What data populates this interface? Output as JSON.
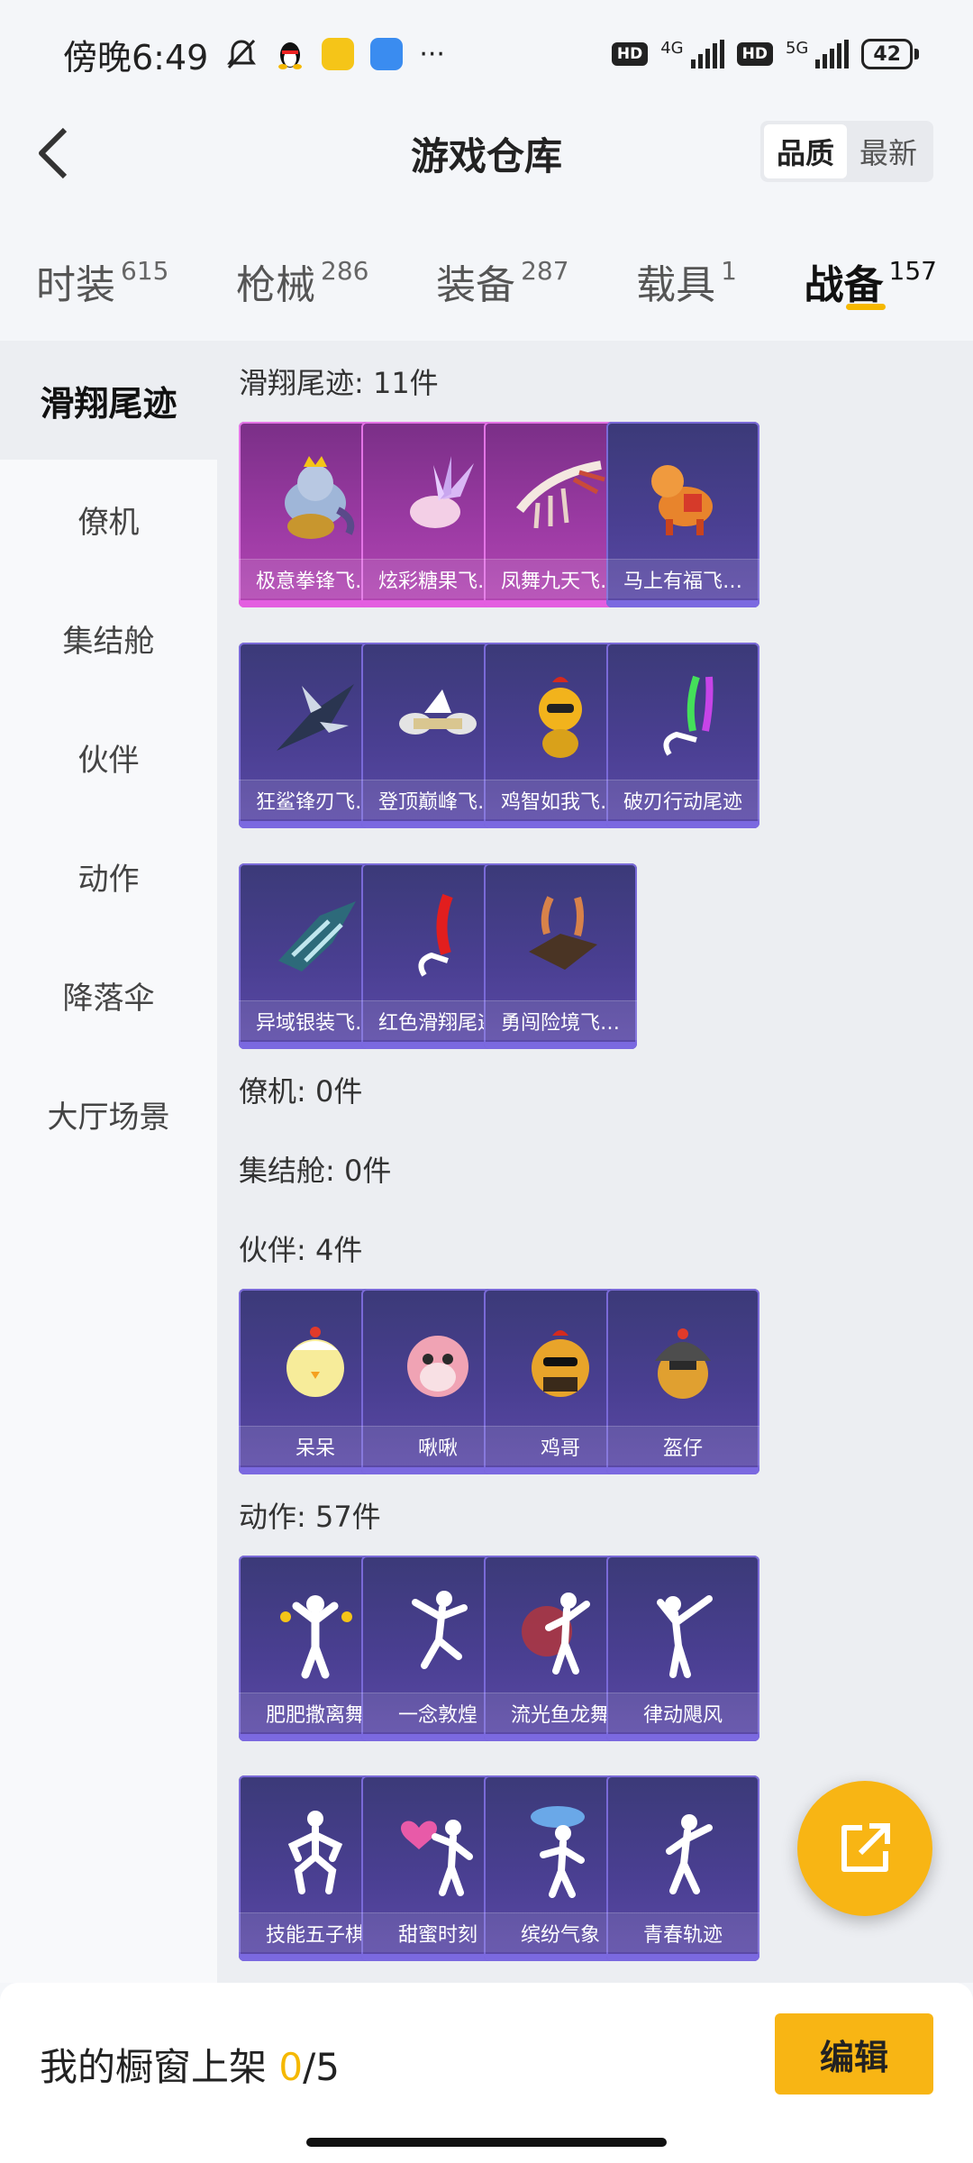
{
  "status_bar": {
    "time": "傍晚6:49",
    "network_1": "4G",
    "network_2": "5G",
    "hd_1": "HD",
    "hd_2": "HD",
    "battery": "42",
    "more": "···"
  },
  "header": {
    "title": "游戏仓库",
    "sort_options": [
      "品质",
      "最新"
    ],
    "active_sort": "品质"
  },
  "tabs": [
    {
      "label": "时装",
      "count": "615"
    },
    {
      "label": "枪械",
      "count": "286"
    },
    {
      "label": "装备",
      "count": "287"
    },
    {
      "label": "载具",
      "count": "1"
    },
    {
      "label": "战备",
      "count": "157"
    }
  ],
  "active_tab": "战备",
  "sidebar": {
    "items": [
      "滑翔尾迹",
      "僚机",
      "集结舱",
      "伙伴",
      "动作",
      "降落伞",
      "大厅场景"
    ],
    "active": "滑翔尾迹"
  },
  "sections": {
    "glide": {
      "title": "滑翔尾迹: 11件",
      "items": [
        {
          "name": "极意拳锋飞…",
          "quality": "purple",
          "icon": "elephant-rider-icon"
        },
        {
          "name": "炫彩糖果飞…",
          "quality": "purple",
          "icon": "candy-wings-icon"
        },
        {
          "name": "凤舞九天飞…",
          "quality": "purple",
          "icon": "phoenix-feather-icon"
        },
        {
          "name": "马上有福飞…",
          "quality": "blue",
          "icon": "toy-horse-icon"
        },
        {
          "name": "狂鲨锋刃飞…",
          "quality": "blue",
          "icon": "shark-glider-icon"
        },
        {
          "name": "登顶巅峰飞…",
          "quality": "blue",
          "icon": "jet-wing-icon"
        },
        {
          "name": "鸡智如我飞…",
          "quality": "blue",
          "icon": "chicken-glider-icon"
        },
        {
          "name": "破刃行动尾迹",
          "quality": "blue",
          "icon": "smoke-trail-icon"
        },
        {
          "name": "异域银装飞…",
          "quality": "blue",
          "icon": "silver-wing-icon"
        },
        {
          "name": "红色滑翔尾迹",
          "quality": "blue",
          "icon": "red-smoke-icon"
        },
        {
          "name": "勇闯险境飞…",
          "quality": "blue",
          "icon": "wingsuit-smoke-icon"
        }
      ]
    },
    "drone": {
      "title": "僚机: 0件"
    },
    "pod": {
      "title": "集结舱: 0件"
    },
    "partner": {
      "title": "伙伴: 4件",
      "items": [
        {
          "name": "呆呆",
          "icon": "chick-icon"
        },
        {
          "name": "啾啾",
          "icon": "pink-bird-icon"
        },
        {
          "name": "鸡哥",
          "icon": "rooster-glasses-icon"
        },
        {
          "name": "盔仔",
          "icon": "helmet-chicken-icon"
        }
      ]
    },
    "emote": {
      "title": "动作: 57件",
      "items": [
        {
          "name": "肥肥撒离舞",
          "icon": "dance-fireworks-icon"
        },
        {
          "name": "一念敦煌",
          "icon": "dance-leap-icon"
        },
        {
          "name": "流光鱼龙舞",
          "icon": "dance-dragon-icon"
        },
        {
          "name": "律动飓风",
          "icon": "dance-wave-icon"
        },
        {
          "name": "技能五子棋",
          "icon": "dance-squat-icon"
        },
        {
          "name": "甜蜜时刻",
          "icon": "dance-heart-icon"
        },
        {
          "name": "缤纷气象",
          "icon": "dance-cloud-icon"
        },
        {
          "name": "青春轨迹",
          "icon": "dance-spin-icon"
        }
      ]
    }
  },
  "bottom_bar": {
    "showcase_label": "我的橱窗上架",
    "showcase_current": "0",
    "showcase_total": "/5",
    "edit_label": "编辑"
  },
  "colors": {
    "accent": "#f8b514",
    "card_blue": "#4a3f92",
    "card_purple": "#9b3aa3"
  }
}
